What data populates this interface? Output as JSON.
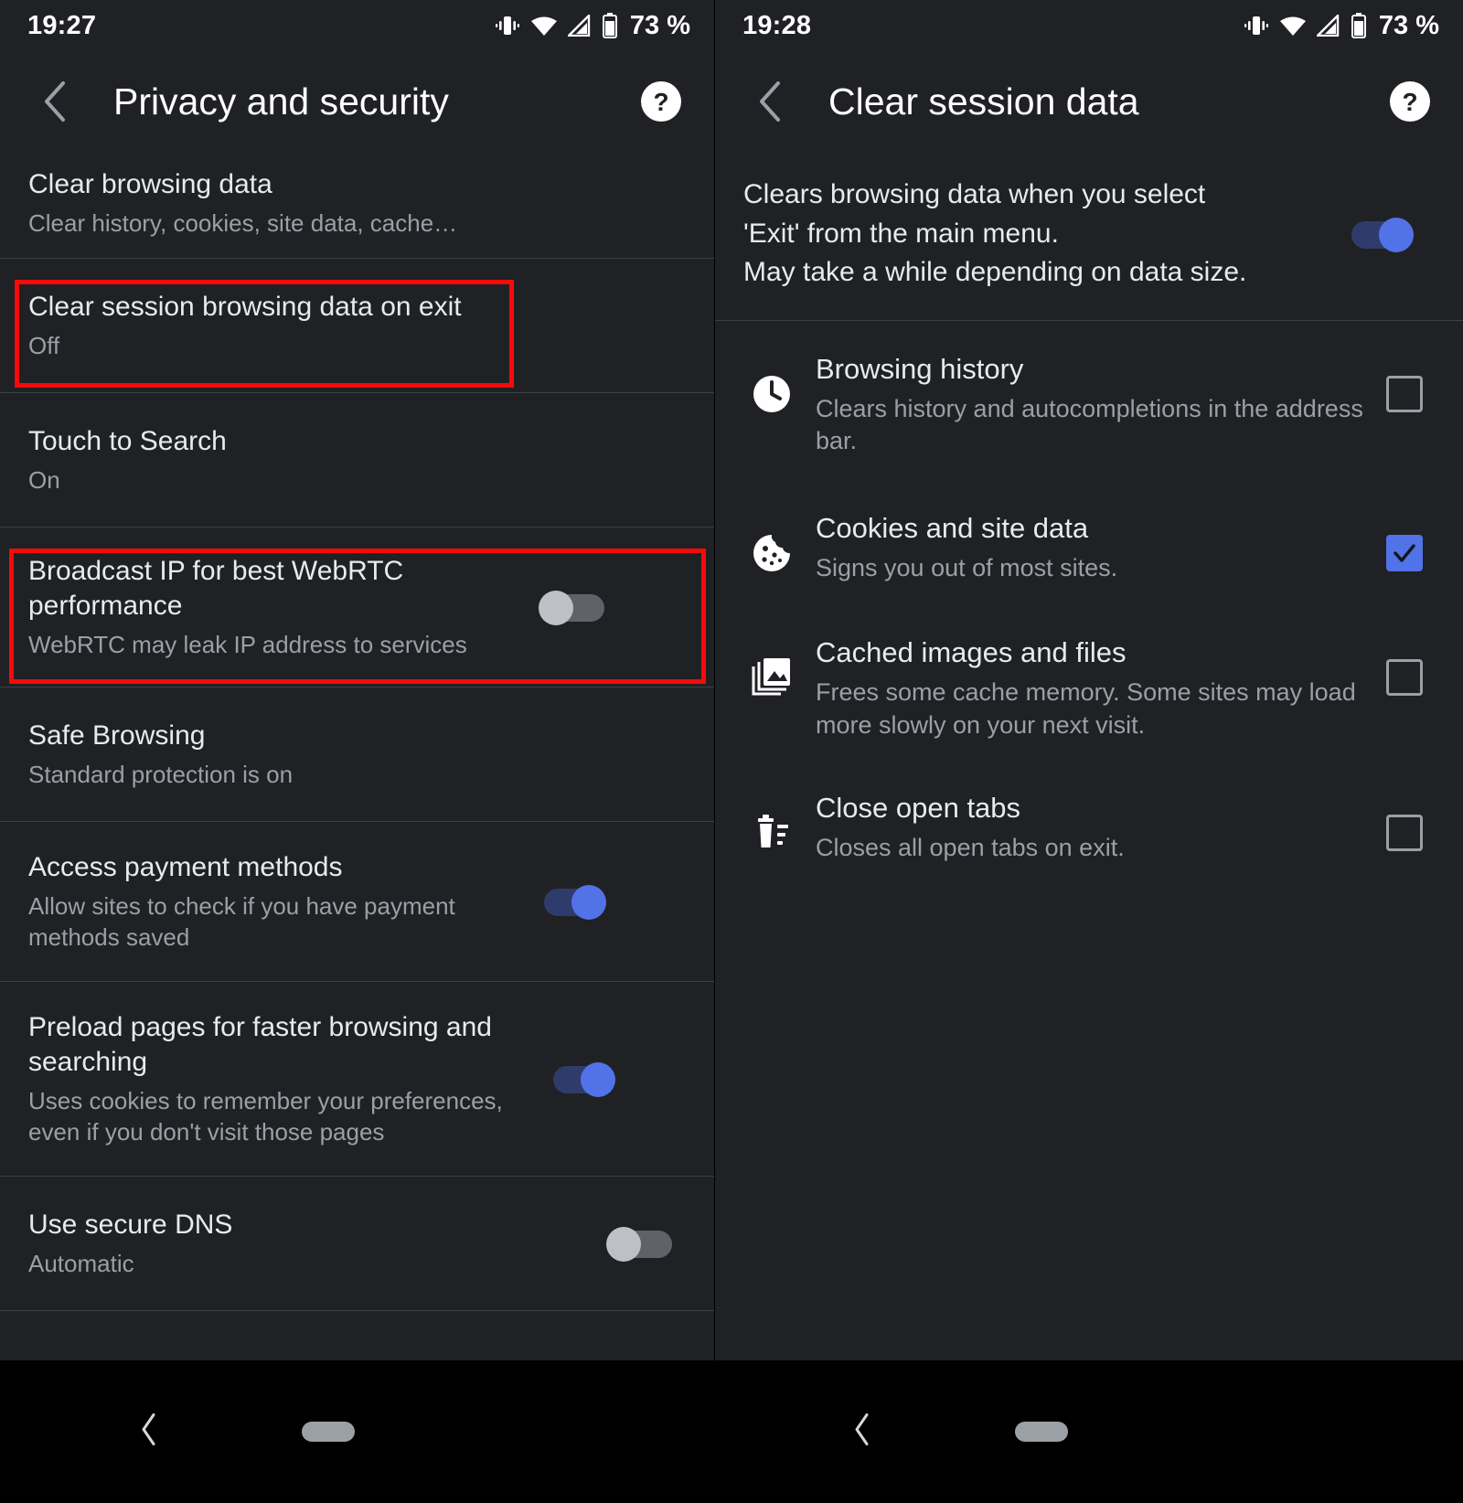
{
  "left_panel": {
    "status_bar": {
      "time": "19:27",
      "battery": "73 %",
      "icons": [
        "vibrate-icon",
        "wifi-icon",
        "signal-icon",
        "battery-icon"
      ]
    },
    "app_bar": {
      "title": "Privacy and security",
      "back_icon": "back-chevron-icon",
      "help_icon": "help-icon"
    },
    "rows": [
      {
        "title": "Clear browsing data",
        "sub": "Clear history, cookies, site data, cache…",
        "control": "none",
        "highlight": false
      },
      {
        "title": "Clear session browsing data on exit",
        "sub": "Off",
        "control": "none",
        "highlight": true
      },
      {
        "title": "Touch to Search",
        "sub": "On",
        "control": "none",
        "highlight": false
      },
      {
        "title": "Broadcast IP for best WebRTC performance",
        "sub": "WebRTC may leak IP address to services",
        "control": "toggle",
        "toggle_state": "off",
        "highlight": true
      },
      {
        "title": "Safe Browsing",
        "sub": "Standard protection is on",
        "control": "none",
        "highlight": false
      },
      {
        "title": "Access payment methods",
        "sub": "Allow sites to check if you have payment methods saved",
        "control": "toggle",
        "toggle_state": "on",
        "highlight": false
      },
      {
        "title": "Preload pages for faster browsing and searching",
        "sub": "Uses cookies to remember your preferences, even if you don't visit those pages",
        "control": "toggle",
        "toggle_state": "on",
        "highlight": false
      },
      {
        "title": "Use secure DNS",
        "sub": "Automatic",
        "control": "toggle",
        "toggle_state": "off",
        "highlight": false
      }
    ]
  },
  "right_panel": {
    "status_bar": {
      "time": "19:28",
      "battery": "73 %",
      "icons": [
        "vibrate-icon",
        "wifi-icon",
        "signal-icon",
        "battery-icon"
      ]
    },
    "app_bar": {
      "title": "Clear session data",
      "back_icon": "back-chevron-icon",
      "help_icon": "help-icon"
    },
    "description": {
      "line1": "Clears browsing data when you select",
      "line2": "'Exit' from the main menu.",
      "line3": "May take a while depending on data size.",
      "toggle_state": "on"
    },
    "options": [
      {
        "icon": "clock-icon",
        "title": "Browsing history",
        "sub": "Clears history and autocompletions in the address bar.",
        "checked": false
      },
      {
        "icon": "cookie-icon",
        "title": "Cookies and site data",
        "sub": "Signs you out of most sites.",
        "checked": true
      },
      {
        "icon": "photo-library-icon",
        "title": "Cached images and files",
        "sub": "Frees some cache memory. Some sites may load more slowly on your next visit.",
        "checked": false
      },
      {
        "icon": "delete-sweep-icon",
        "title": "Close open tabs",
        "sub": "Closes all open tabs on exit.",
        "checked": false
      }
    ]
  },
  "nav_bar": {
    "back_icon": "nav-back-icon",
    "home_icon": "nav-home-pill-icon"
  },
  "colors": {
    "background": "#202124",
    "accent_blue": "#5272e8",
    "highlight_red": "#f60a0a",
    "toggle_off_track": "#5f6368",
    "toggle_off_knob": "#bdc1c6",
    "divider": "#3c4043"
  }
}
